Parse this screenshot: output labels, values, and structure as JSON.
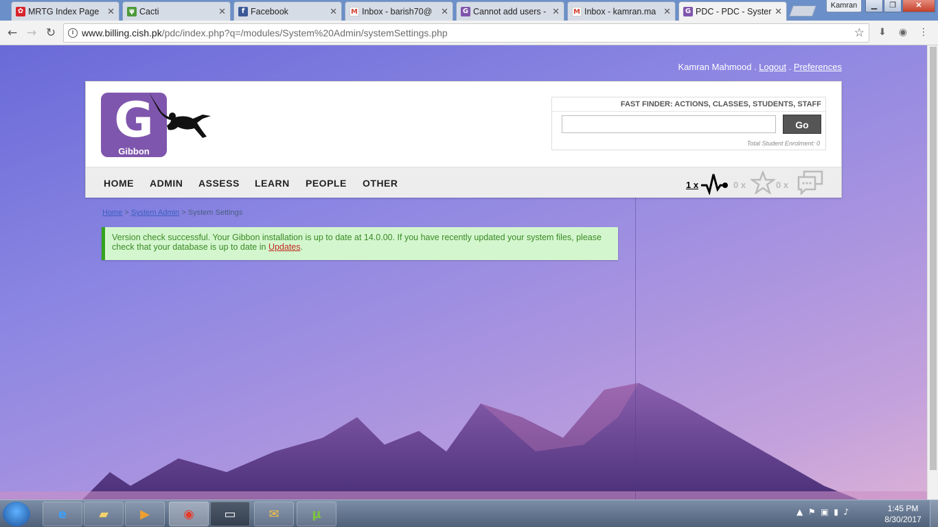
{
  "browser": {
    "tabs": [
      {
        "title": "MRTG Index Page",
        "icon": "huawei-icon"
      },
      {
        "title": "Cacti",
        "icon": "cacti-icon"
      },
      {
        "title": "Facebook",
        "icon": "facebook-icon"
      },
      {
        "title": "Inbox - barish70@",
        "icon": "gmail-icon"
      },
      {
        "title": "Cannot add users -",
        "icon": "gibbon-icon"
      },
      {
        "title": "Inbox - kamran.ma",
        "icon": "gmail-icon"
      },
      {
        "title": "PDC - PDC - Syster",
        "icon": "gibbon-icon"
      }
    ],
    "user_badge": "Kamran",
    "url_host": "www.billing.cish.pk",
    "url_path": "/pdc/index.php?q=/modules/System%20Admin/systemSettings.php"
  },
  "page": {
    "user_name": "Kamran Mahmood",
    "logout_label": "Logout",
    "preferences_label": "Preferences",
    "logo_letter": "G",
    "logo_word": "Gibbon",
    "fast_finder_title": "FAST FINDER: ACTIONS, CLASSES, STUDENTS, STAFF",
    "go_label": "Go",
    "enrolment_text": "Total Student Enrolment: 0",
    "menu": [
      "HOME",
      "ADMIN",
      "ASSESS",
      "LEARN",
      "PEOPLE",
      "OTHER"
    ],
    "notifications": {
      "alarm": "1 x",
      "likes": "0 x",
      "messages": "0 x"
    },
    "breadcrumb": {
      "home": "Home",
      "module": "System Admin",
      "current": "System Settings",
      "sep": ">"
    },
    "alert_text": "Version check successful. Your Gibbon installation is up to date at 14.0.00. If you have recently updated your system files, please check that your database is up to date in ",
    "alert_link": "Updates",
    "alert_end": "."
  },
  "taskbar": {
    "time": "1:45 PM",
    "date": "8/30/2017"
  },
  "colors": {
    "gibbon_purple": "#7f56ad",
    "success_bg": "#d4f6ce",
    "success_border": "#35a31f"
  }
}
